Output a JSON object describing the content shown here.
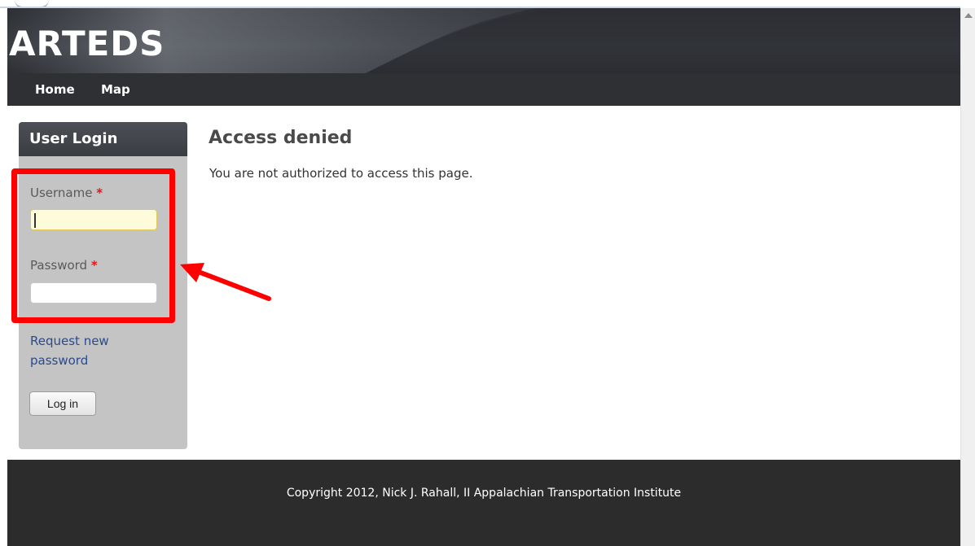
{
  "site": {
    "name": "ARTEDS"
  },
  "nav": {
    "items": [
      {
        "label": "Home"
      },
      {
        "label": "Map"
      }
    ]
  },
  "login_block": {
    "title": "User Login",
    "username_label": "Username",
    "password_label": "Password",
    "required_marker": "*",
    "username_value": "",
    "password_value": "",
    "request_password_link": "Request new password",
    "login_button": "Log in"
  },
  "main": {
    "title": "Access denied",
    "message": "You are not authorized to access this page."
  },
  "footer": {
    "text": "Copyright 2012, Nick J. Rahall, II Appalachian Transportation Institute"
  },
  "annotation": {
    "highlight_color": "#ff0000",
    "arrow_color": "#ff0000"
  }
}
